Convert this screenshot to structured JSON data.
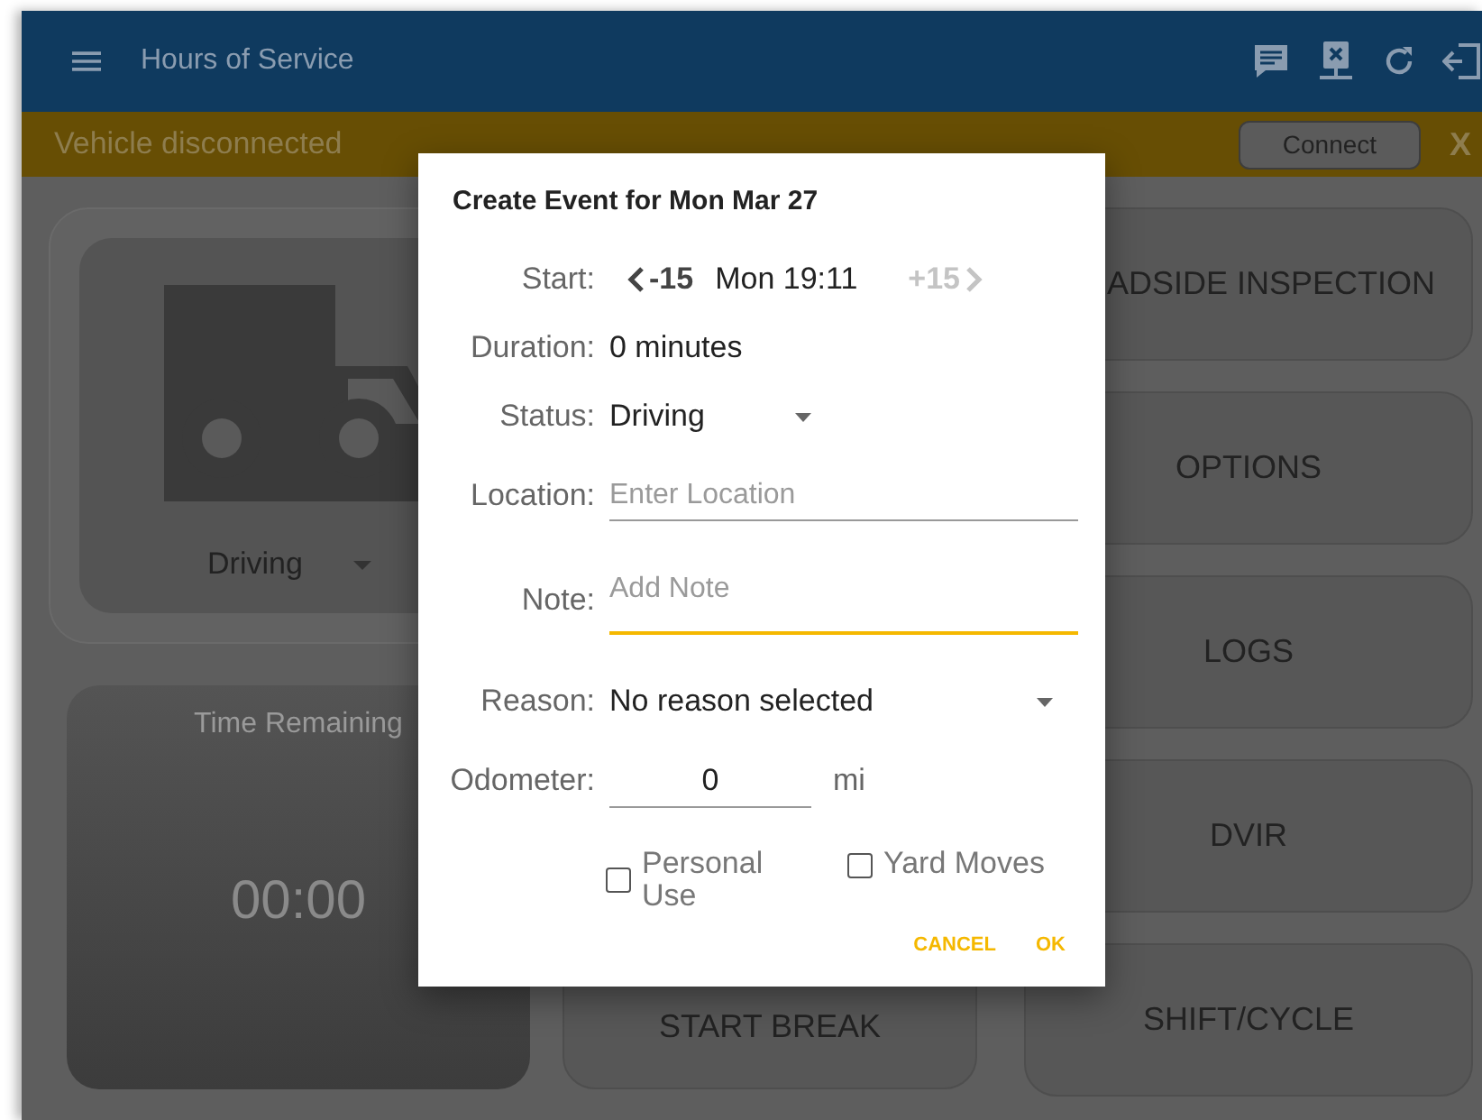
{
  "app_bar": {
    "title": "Hours of Service"
  },
  "banner": {
    "message": "Vehicle disconnected",
    "button": "Connect",
    "close": "X"
  },
  "status_card": {
    "status": "Driving"
  },
  "time_card": {
    "label": "Time Remaining",
    "value": "00:00"
  },
  "break_card": {
    "label": "START BREAK"
  },
  "menu_buttons": [
    "ADSIDE INSPECTION",
    "OPTIONS",
    "LOGS",
    "DVIR",
    "SHIFT/CYCLE"
  ],
  "dialog": {
    "title": "Create Event for Mon Mar 27",
    "start": {
      "label": "Start:",
      "back": "-15",
      "time": "Mon 19:11",
      "forward": "+15",
      "forward_disabled": true
    },
    "duration": {
      "label": "Duration:",
      "value": "0 minutes"
    },
    "status": {
      "label": "Status:",
      "value": "Driving"
    },
    "location": {
      "label": "Location:",
      "placeholder": "Enter Location",
      "focused": false
    },
    "note": {
      "label": "Note:",
      "placeholder": "Add Note",
      "focused": true
    },
    "reason": {
      "label": "Reason:",
      "value": "No reason selected"
    },
    "odometer": {
      "label": "Odometer:",
      "value": "0",
      "unit": "mi"
    },
    "checkboxes": [
      {
        "label": "Personal Use",
        "checked": false
      },
      {
        "label": "Yard Moves",
        "checked": false
      }
    ],
    "buttons": [
      "CANCEL",
      "OK"
    ]
  }
}
